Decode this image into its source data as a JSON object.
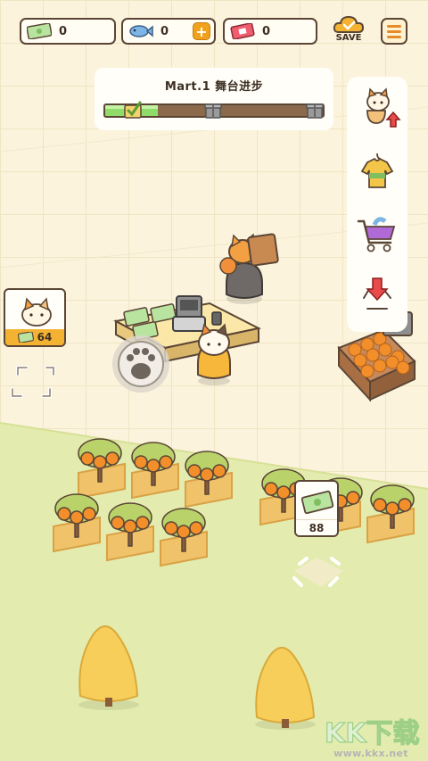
{
  "hud": {
    "cash": {
      "icon": "cash-icon",
      "value": "0"
    },
    "fish": {
      "icon": "fish-icon",
      "value": "0",
      "add_label": "+"
    },
    "ticket": {
      "icon": "ticket-icon",
      "value": "0"
    },
    "save_label": "SAVE",
    "menu_icon": "menu-icon"
  },
  "progress": {
    "title": "Mart.1 舞台进步",
    "fill_fraction": 0.24,
    "milestones": [
      "check-icon",
      "gift-icon",
      "gift-icon"
    ]
  },
  "side_menu": {
    "items": [
      {
        "icon": "cat-upgrade-icon"
      },
      {
        "icon": "shirt-icon"
      },
      {
        "icon": "shopping-cart-icon"
      },
      {
        "icon": "recycle-download-icon"
      }
    ]
  },
  "scene": {
    "hire_cat_price": "64",
    "plot_price": "88",
    "paw_icon": "paw-icon"
  },
  "watermark": {
    "logo_text": "KK下载",
    "url": "www.kkx.net"
  },
  "colors": {
    "accent_orange": "#f3b232",
    "outline_brown": "#5b4636",
    "progress_green": "#8fdc6a",
    "grass_green": "#e3ecae"
  }
}
